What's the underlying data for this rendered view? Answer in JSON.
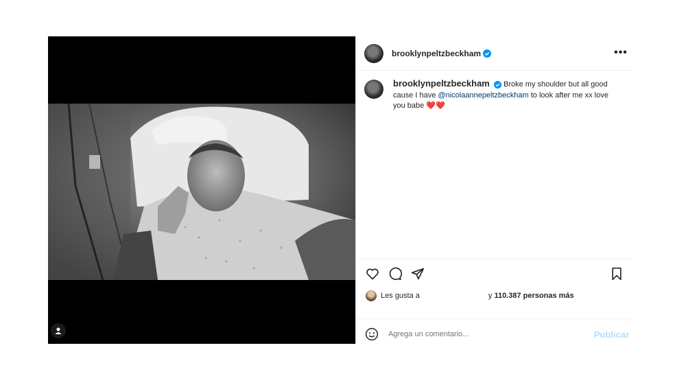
{
  "post": {
    "username": "brooklynpeltzbeckham",
    "verified": true,
    "more_icon": "more-horizontal-icon"
  },
  "caption": {
    "username": "brooklynpeltzbeckham",
    "text_before": "Broke my shoulder but all good cause I have ",
    "mention": "@nicolaannepeltzbeckham",
    "text_after": " to look after me xx love you babe ",
    "emoji": "❤️❤️"
  },
  "actions": {
    "like_icon": "heart-icon",
    "comment_icon": "comment-icon",
    "share_icon": "share-icon",
    "save_icon": "bookmark-icon"
  },
  "likes": {
    "prefix": "Les gusta a",
    "suffix_pre": "y ",
    "count": "110.387 personas más"
  },
  "comment_box": {
    "placeholder": "Agrega un comentario...",
    "publish_label": "Publicar"
  },
  "colors": {
    "verified": "#0095f6",
    "mention": "#00376b",
    "publish_disabled": "#b2dffc",
    "heart": "#ed4956"
  }
}
